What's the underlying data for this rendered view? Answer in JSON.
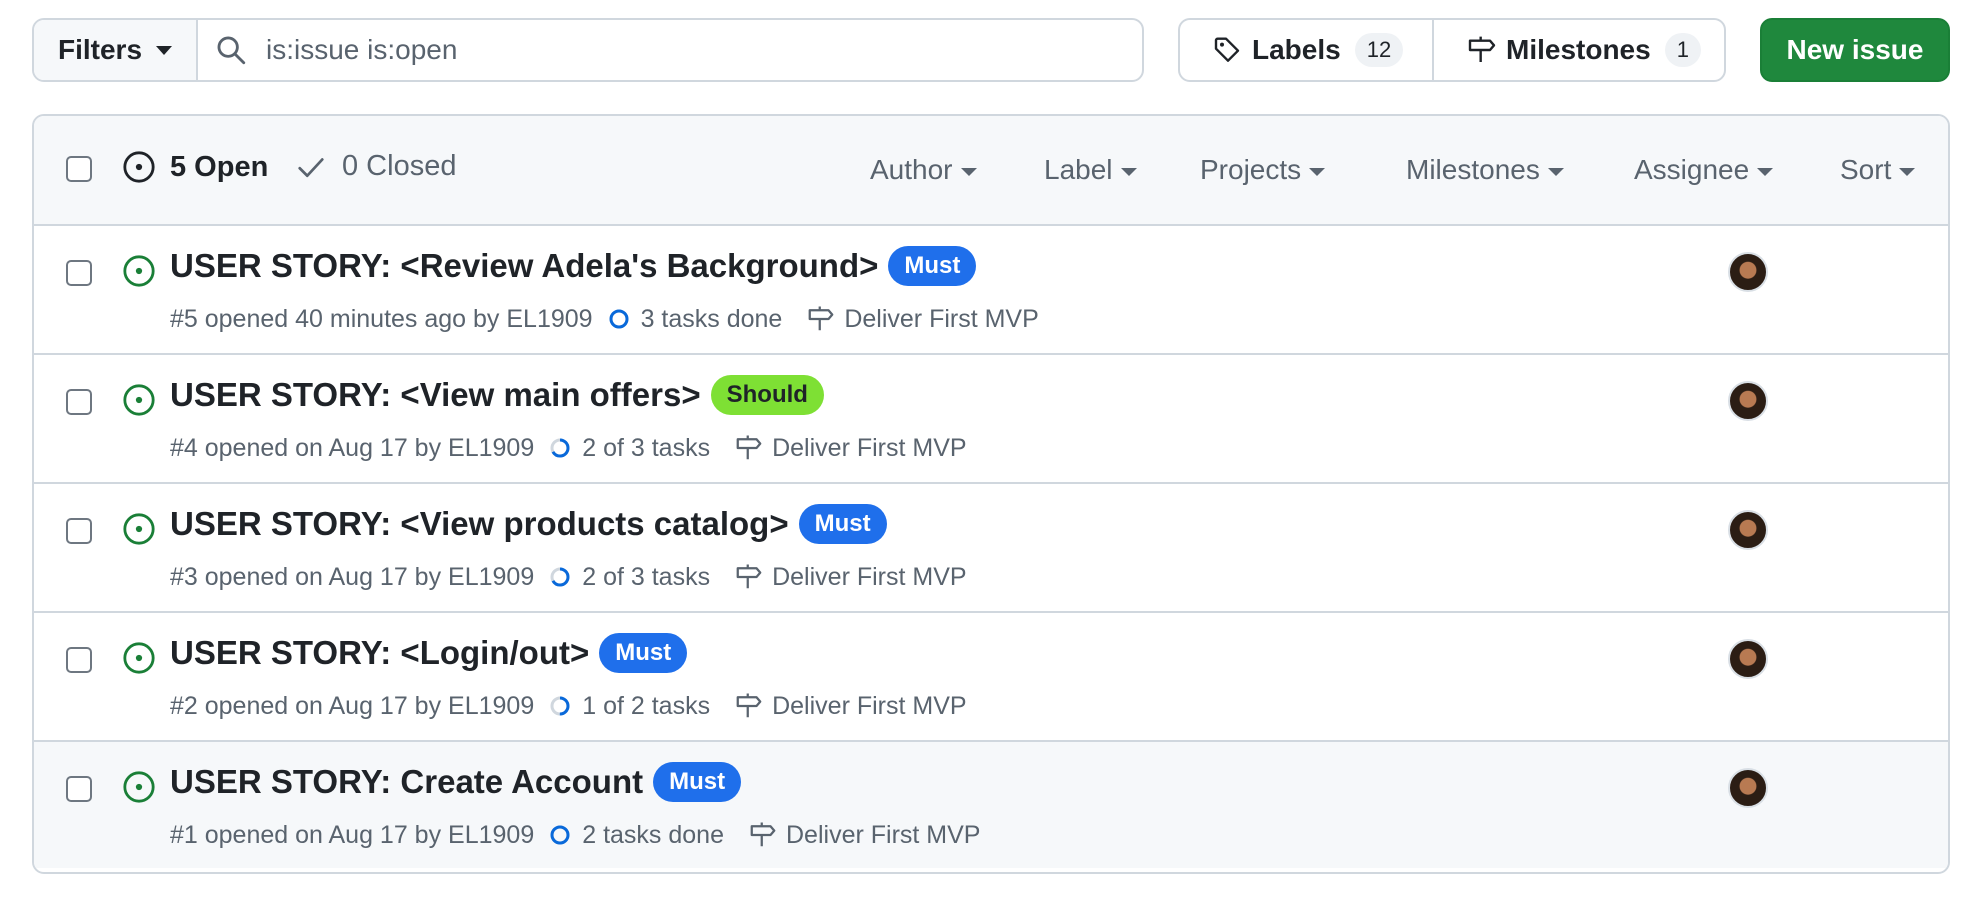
{
  "toolbar": {
    "filters_label": "Filters",
    "search_value": "is:issue is:open",
    "labels_label": "Labels",
    "labels_count": "12",
    "milestones_label": "Milestones",
    "milestones_count": "1",
    "new_issue_label": "New issue"
  },
  "header": {
    "open_label": "5 Open",
    "closed_label": "0 Closed",
    "filters": [
      "Author",
      "Label",
      "Projects",
      "Milestones",
      "Assignee",
      "Sort"
    ]
  },
  "colors": {
    "open_green": "#1a7f37",
    "label_must": "#1f6feb",
    "label_should": "#7ee034",
    "progress_blue": "#0969da",
    "primary_button": "#1f883d"
  },
  "issues": [
    {
      "title": "USER STORY: <Review Adela's Background>",
      "label": "Must",
      "meta": "#5 opened 40 minutes ago by EL1909",
      "tasks": "3 tasks done",
      "tasks_done_fraction": 1,
      "milestone": "Deliver First MVP"
    },
    {
      "title": "USER STORY: <View main offers>",
      "label": "Should",
      "meta": "#4 opened on Aug 17 by EL1909",
      "tasks": "2 of 3 tasks",
      "tasks_done_fraction": 0.667,
      "milestone": "Deliver First MVP"
    },
    {
      "title": "USER STORY: <View products catalog>",
      "label": "Must",
      "meta": "#3 opened on Aug 17 by EL1909",
      "tasks": "2 of 3 tasks",
      "tasks_done_fraction": 0.667,
      "milestone": "Deliver First MVP"
    },
    {
      "title": "USER STORY: <Login/out>",
      "label": "Must",
      "meta": "#2 opened on Aug 17 by EL1909",
      "tasks": "1 of 2 tasks",
      "tasks_done_fraction": 0.5,
      "milestone": "Deliver First MVP"
    },
    {
      "title": "USER STORY: Create Account",
      "label": "Must",
      "meta": "#1 opened on Aug 17 by EL1909",
      "tasks": "2 tasks done",
      "tasks_done_fraction": 1,
      "milestone": "Deliver First MVP"
    }
  ]
}
